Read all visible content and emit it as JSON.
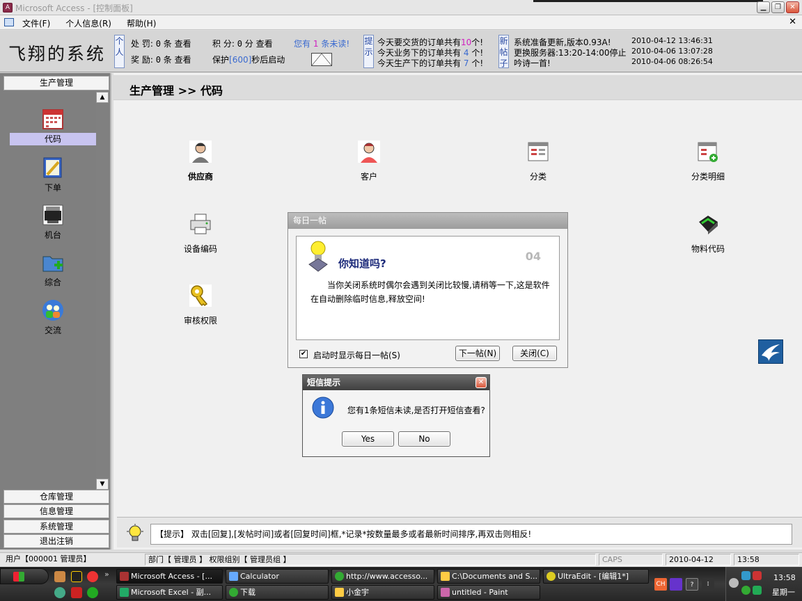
{
  "window": {
    "title": "Microsoft Access - [控制面板]"
  },
  "menu": [
    "文件(F)",
    "个人信息(R)",
    "帮助(H)"
  ],
  "header": {
    "brand": "飞翔的系统",
    "personal_box": "个人",
    "punish_label": "处 罚:",
    "punish_value": "0",
    "reward_label": "奖 励:",
    "reward_value": "0",
    "unit_tiao": "条",
    "view_link": "查看",
    "points_label": "积 分:",
    "points_value": "0",
    "points_unit": "分",
    "protect_prefix": "保护",
    "protect_value": "[600]",
    "protect_suffix": "秒后启动",
    "unread_prefix": "您有",
    "unread_count": "1",
    "unread_suffix": "条未读!",
    "tip_box": "提示",
    "order_tips": [
      {
        "text": "今天要交货的订单共有",
        "count": "10",
        "unit": "个!"
      },
      {
        "text": "今天业务下的订单共有",
        "count": "4",
        "unit": "个!"
      },
      {
        "text": "今天生产下的订单共有",
        "count": "7",
        "unit": "个!"
      }
    ],
    "news_box": "新帖子",
    "news": [
      {
        "text": "系统准备更新,版本0.93A!",
        "time": "2010-04-12 13:46:31"
      },
      {
        "text": "更换服务器:13:20-14:00停止",
        "time": "2010-04-06 13:07:28"
      },
      {
        "text": "吟诗一首!",
        "time": "2010-04-06 08:26:54"
      }
    ]
  },
  "sidebar": {
    "section": "生产管理",
    "items": [
      "代码",
      "下单",
      "机台",
      "综合",
      "交流"
    ],
    "bottom": [
      "仓库管理",
      "信息管理",
      "系统管理",
      "退出注销"
    ]
  },
  "main": {
    "breadcrumb": "生产管理 >> 代码",
    "tiles": [
      "供应商",
      "客户",
      "分类",
      "分类明细",
      "设备编码",
      "物料代码",
      "审核权限"
    ]
  },
  "tip_dialog": {
    "title": "每日一帖",
    "question": "你知道吗?",
    "number": "04",
    "text": "当你关闭系统时偶尔会遇到关闭比较慢,请稍等一下,这是软件在自动删除临时信息,释放空间!",
    "checkbox_label": "启动时显示每日一帖(S)",
    "checkbox_checked": "✔",
    "next_button": "下一帖(N)",
    "close_button": "关闭(C)"
  },
  "sms_dialog": {
    "title": "短信提示",
    "message": "您有1条短信未读,是否打开短信查看?",
    "yes": "Yes",
    "no": "No"
  },
  "hint": {
    "text": "【提示】 双击[回复],[发帖时间]或者[回复时间]框,*记录*按数量最多或者最新时间排序,再双击则相反!"
  },
  "status": {
    "user": "用户【000001 管理员】",
    "dept": "部门【 管理员 】 权限组别【 管理员组 】",
    "caps": "CAPS",
    "date": "2010-04-12",
    "time": "13:58"
  },
  "taskbar": {
    "tasks_row1": [
      "Microsoft Access - [...",
      "Calculator",
      "http://www.accesso...",
      "C:\\Documents and S...",
      "UltraEdit - [编辑1*]"
    ],
    "tasks_row2": [
      "Microsoft Excel - 副...",
      "下载",
      "小金宇",
      "untitled - Paint"
    ],
    "ime": "CH",
    "clock": "13:58",
    "day": "星期一"
  },
  "colors": {
    "accent_blue": "#3a6ad0",
    "unread_pink": "#d020c0",
    "selected_item": "#c8c4f0"
  }
}
